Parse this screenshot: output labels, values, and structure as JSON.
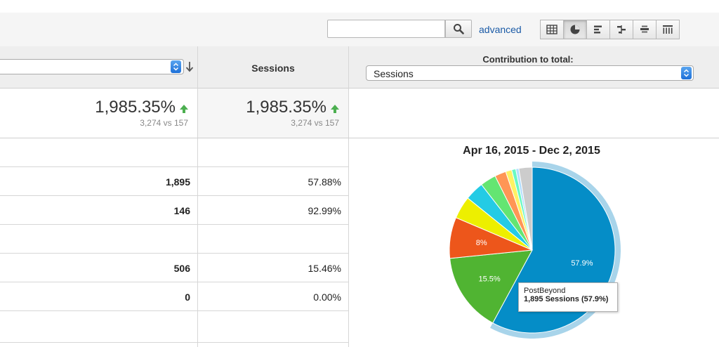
{
  "toolbar": {
    "search_placeholder": "",
    "advanced_label": "advanced",
    "views": [
      {
        "icon": "grid-table-icon",
        "active": false
      },
      {
        "icon": "pie-chart-icon",
        "active": true
      },
      {
        "icon": "bar-performance-icon",
        "active": false
      },
      {
        "icon": "comparison-icon",
        "active": false
      },
      {
        "icon": "term-cloud-icon",
        "active": false
      },
      {
        "icon": "pivot-icon",
        "active": false
      }
    ]
  },
  "table": {
    "sessions_header": "Sessions",
    "contribution_label": "Contribution to total:",
    "contribution_metric": "Sessions",
    "summary": [
      {
        "pct": "1,985.35%",
        "sub": "3,274 vs 157"
      },
      {
        "pct": "1,985.35%",
        "sub": "3,274 vs 157"
      }
    ],
    "rows": [
      {
        "value": "",
        "pct": ""
      },
      {
        "value": "1,895",
        "pct": "57.88%"
      },
      {
        "value": "146",
        "pct": "92.99%"
      },
      {
        "value": "",
        "pct": ""
      },
      {
        "value": "506",
        "pct": "15.46%"
      },
      {
        "value": "0",
        "pct": "0.00%"
      },
      {
        "value": "",
        "pct": ""
      }
    ]
  },
  "chart_data": {
    "type": "pie",
    "title": "Apr 16, 2015 - Dec 2, 2015",
    "slices": [
      {
        "label": "57.9%",
        "value": 57.9,
        "color": "#058dc7"
      },
      {
        "label": "15.5%",
        "value": 15.5,
        "color": "#50b432"
      },
      {
        "label": "8%",
        "value": 8.0,
        "color": "#ed561b"
      },
      {
        "label": "",
        "value": 4.4,
        "color": "#edef00"
      },
      {
        "label": "",
        "value": 3.7,
        "color": "#24cbe5"
      },
      {
        "label": "",
        "value": 3.1,
        "color": "#64e572"
      },
      {
        "label": "",
        "value": 2.2,
        "color": "#ff9655"
      },
      {
        "label": "",
        "value": 1.2,
        "color": "#fff263"
      },
      {
        "label": "",
        "value": 0.8,
        "color": "#6af9c4"
      },
      {
        "label": "",
        "value": 0.6,
        "color": "#b2deff"
      },
      {
        "label": "",
        "value": 2.6,
        "color": "#cccccc"
      }
    ],
    "highlight_index": 0,
    "tooltip": {
      "name": "PostBeyond",
      "detail": "1,895 Sessions (57.9%)"
    }
  }
}
